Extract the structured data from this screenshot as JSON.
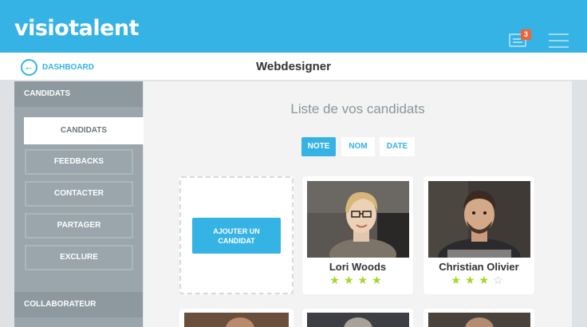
{
  "app": {
    "logo": "visiotalent",
    "notification_count": "3"
  },
  "subheader": {
    "back_label": "DASHBOARD",
    "title": "Webdesigner"
  },
  "sidebar": {
    "section_title": "CANDIDATS",
    "active_item": "CANDIDATS",
    "items": [
      "FEEDBACKS",
      "CONTACTER",
      "PARTAGER",
      "EXCLURE"
    ],
    "footer_section": "COLLABORATEUR"
  },
  "main": {
    "title": "Liste de vos candidats",
    "sort": {
      "note": "NOTE",
      "nom": "NOM",
      "date": "DATE",
      "active": "NOTE"
    },
    "add_candidate_label_line1": "AJOUTER UN",
    "add_candidate_label_line2": "CANDIDAT",
    "candidates": [
      {
        "name": "Lori Woods",
        "rating": 4,
        "max": 4
      },
      {
        "name": "Christian Olivier",
        "rating": 3,
        "max": 4
      }
    ]
  },
  "colors": {
    "brand": "#35b3e5",
    "badge": "#ef6436",
    "star": "#a8d42b"
  }
}
